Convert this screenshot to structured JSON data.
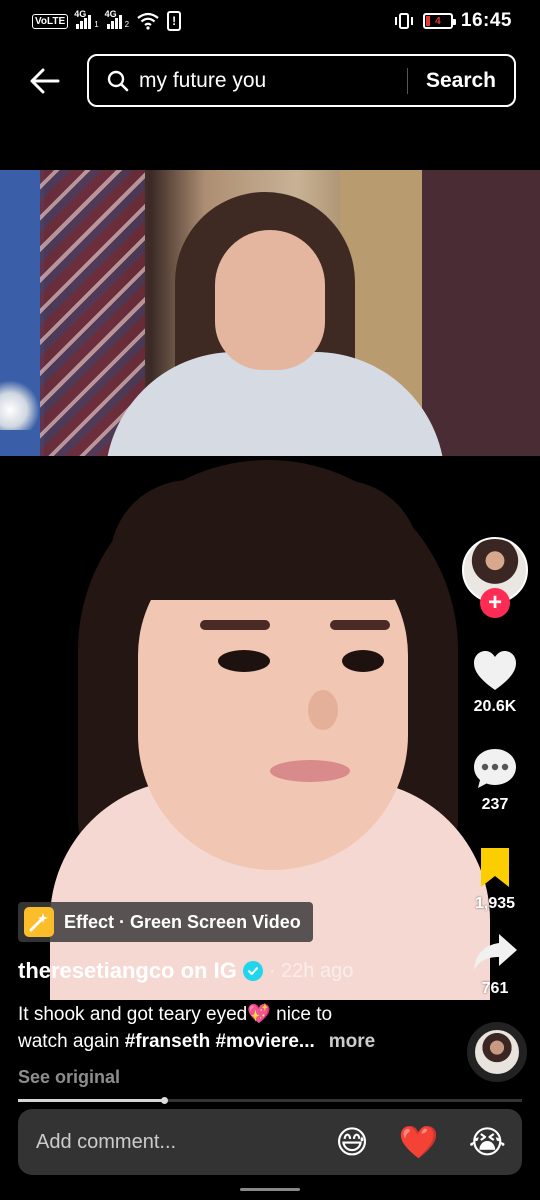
{
  "status_bar": {
    "volte": "VoLTE",
    "network1": "4G",
    "sim1": "1",
    "network2": "4G",
    "sim2": "2",
    "alert": "!",
    "battery_level": "4",
    "time": "16:45"
  },
  "header": {
    "search_query": "my future you",
    "search_button": "Search"
  },
  "post": {
    "effect_label": "Effect · Green Screen Video",
    "username": "theresetiangco on IG",
    "time_ago": "· 22h ago",
    "caption_line1": "It shook and got teary eyed💖 nice to",
    "caption_line2_text": "watch again ",
    "caption_tags": "#franseth #moviere...",
    "caption_more": "more",
    "see_original": "See original",
    "progress": 0.29
  },
  "actions": {
    "likes": "20.6K",
    "comments": "237",
    "saves": "1,935",
    "shares": "761",
    "follow_symbol": "+"
  },
  "comment_bar": {
    "placeholder": "Add comment...",
    "emoji1": "😅",
    "emoji2": "❤️",
    "emoji3": "😭"
  },
  "colors": {
    "follow": "#fe2c55",
    "save": "#fcce00",
    "verified": "#20d5ec",
    "effect": "#fbbd2a"
  },
  "icons": [
    "back-arrow-icon",
    "search-icon",
    "heart-icon",
    "comment-icon",
    "bookmark-icon",
    "share-icon",
    "verified-icon",
    "effect-icon"
  ]
}
